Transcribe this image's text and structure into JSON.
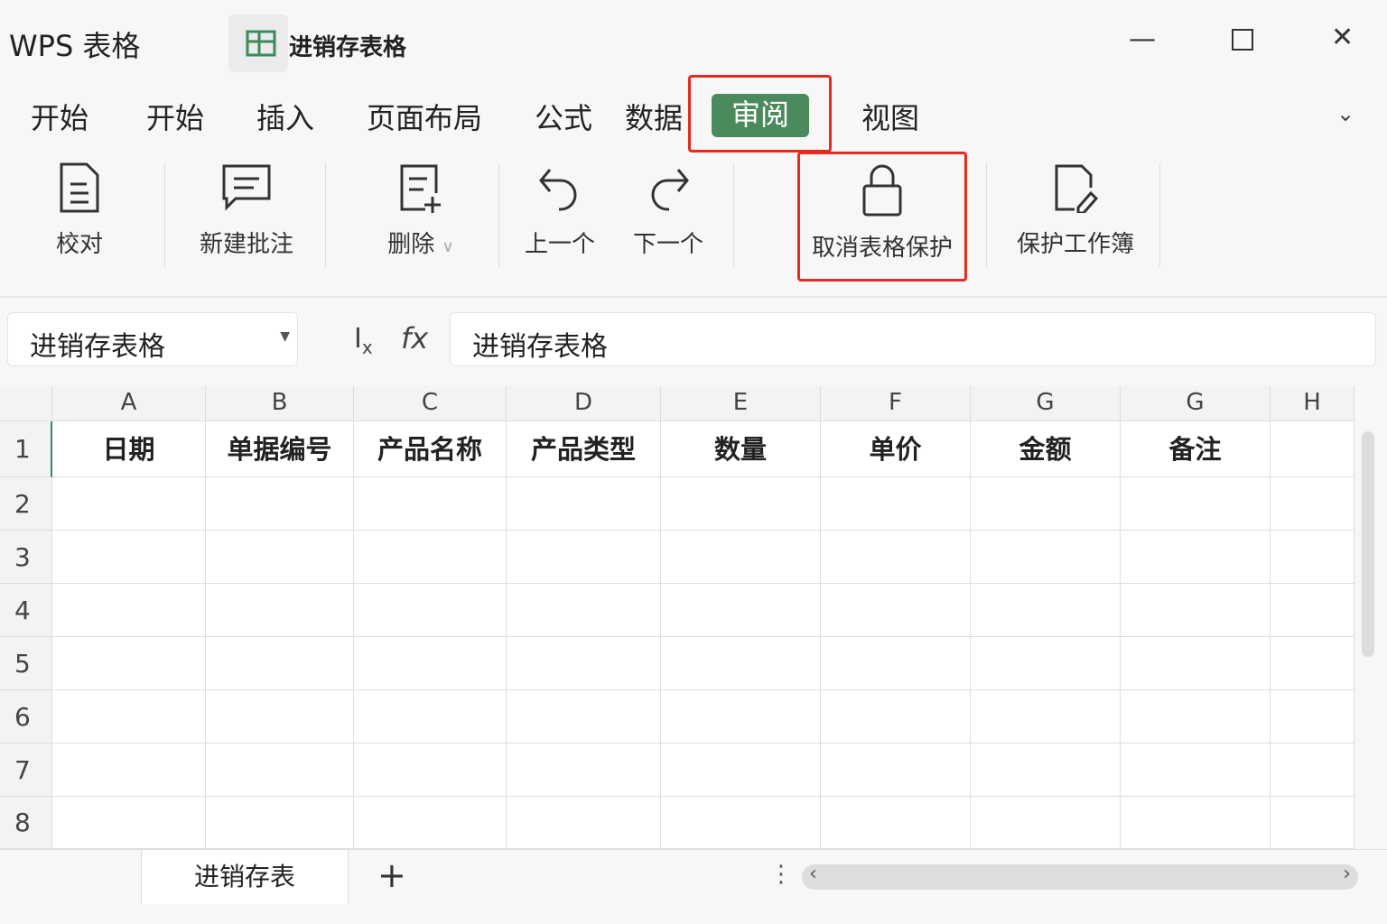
{
  "app": {
    "brand": "WPS 表格",
    "doc_title": "进销存表格"
  },
  "menu": [
    "开始",
    "开始",
    "插入",
    "页面布局",
    "公式",
    "数据",
    "审阅",
    "视图"
  ],
  "ribbon": {
    "proof": "校对",
    "new_comment": "新建批注",
    "delete": "删除",
    "prev": "上一个",
    "next": "下一个",
    "unprotect": "取消表格保护",
    "protect_book": "保护工作簿"
  },
  "formula": {
    "name_box": "进销存表格",
    "value": "进销存表格"
  },
  "columns": [
    "A",
    "B",
    "C",
    "D",
    "E",
    "F",
    "G",
    "G",
    "H"
  ],
  "rows": [
    "1",
    "2",
    "3",
    "4",
    "5",
    "6",
    "7",
    "8"
  ],
  "headers": [
    "日期",
    "单据编号",
    "产品名称",
    "产品类型",
    "数量",
    "单价",
    "金额",
    "备注",
    ""
  ],
  "sheet_tab": "进销存表",
  "colors": {
    "accent": "#4a8a5c",
    "highlight": "#e52b20"
  }
}
